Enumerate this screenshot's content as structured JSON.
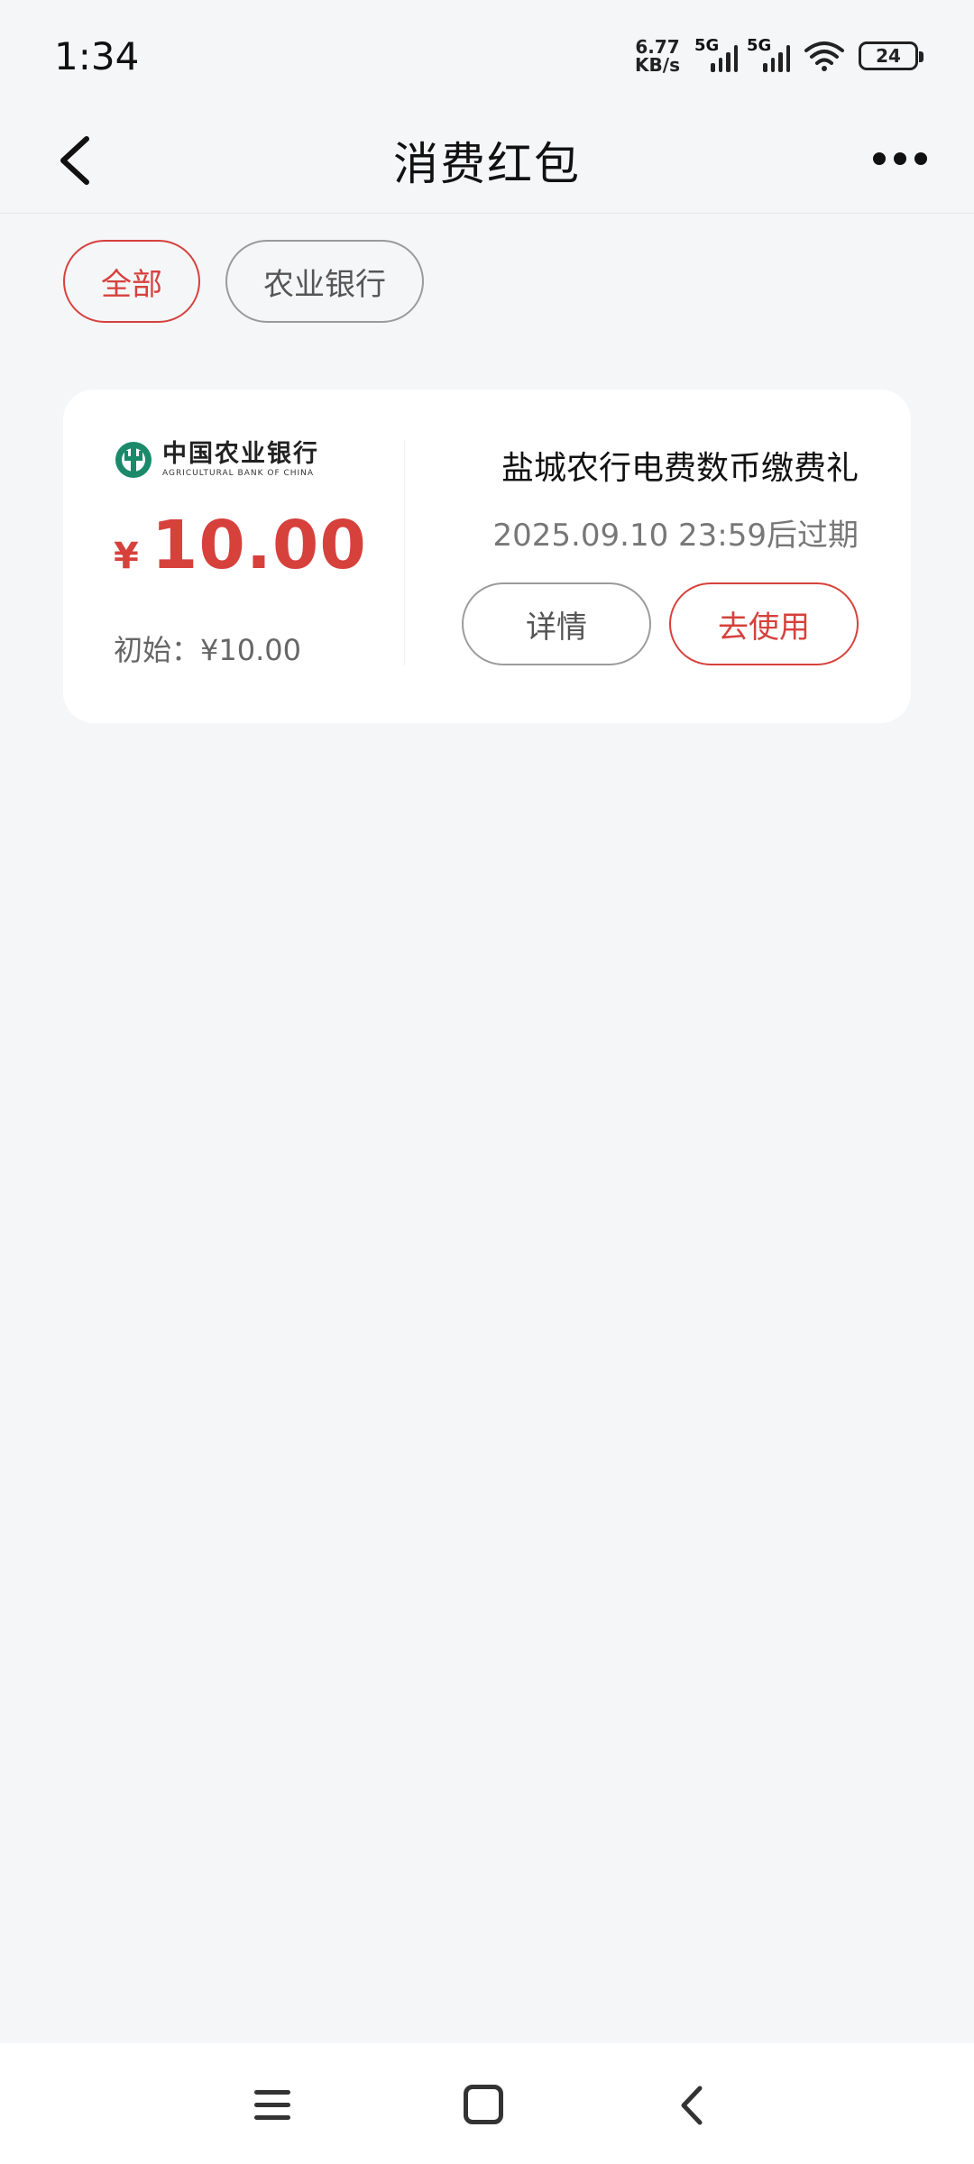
{
  "status_bar": {
    "time": "1:34",
    "net_speed_value": "6.77",
    "net_speed_unit": "KB/s",
    "signal1": "5G",
    "signal2": "5G",
    "battery": "24"
  },
  "nav": {
    "title": "消费红包",
    "back_icon": "chevron-left-icon",
    "more_icon": "more-horizontal-icon"
  },
  "filters": [
    {
      "label": "全部",
      "active": true
    },
    {
      "label": "农业银行",
      "active": false
    }
  ],
  "card": {
    "bank_name_cn": "中国农业银行",
    "bank_name_en": "AGRICULTURAL BANK OF CHINA",
    "currency": "¥",
    "amount": "10.00",
    "initial": "初始：¥10.00",
    "title": "盐城农行电费数币缴费礼",
    "expire": "2025.09.10 23:59后过期",
    "detail_label": "详情",
    "use_label": "去使用"
  },
  "colors": {
    "accent": "#d6413c",
    "background": "#f5f6f8"
  }
}
